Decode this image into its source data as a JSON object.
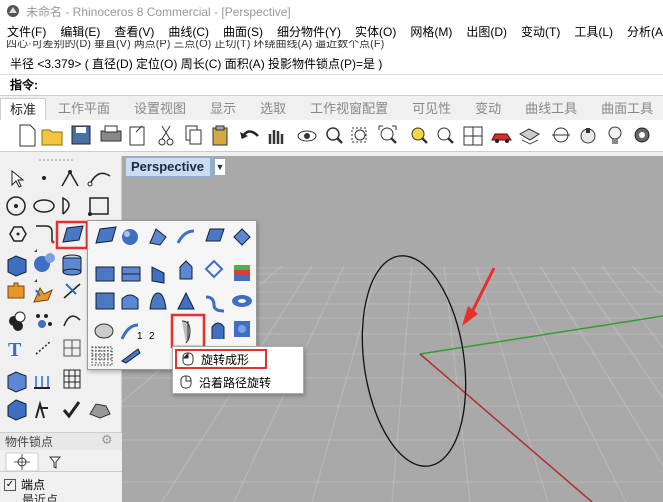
{
  "titlebar": {
    "text": "未命名 - Rhinoceros 8 Commercial - [Perspective]"
  },
  "menus": [
    "文件(F)",
    "编辑(E)",
    "查看(V)",
    "曲线(C)",
    "曲面(S)",
    "细分物件(Y)",
    "实体(O)",
    "网格(M)",
    "出图(D)",
    "变动(T)",
    "工具(L)",
    "分析(A)"
  ],
  "command": {
    "history": "四心·可差别的(D)  垂直(V)  两点(P)  三点(O)  正切(T)  环绕曲线(A)  逼近数个点(F)",
    "line1": "半径 <3.379> ( 直径(D)  定位(O)  周长(C)  面积(A)  投影物件锁点(P)=是 )",
    "prompt": "指令:"
  },
  "tabs": [
    {
      "label": "标准",
      "active": true
    },
    {
      "label": "工作平面"
    },
    {
      "label": "设置视图"
    },
    {
      "label": "显示"
    },
    {
      "label": "选取"
    },
    {
      "label": "工作视窗配置"
    },
    {
      "label": "可见性"
    },
    {
      "label": "变动"
    },
    {
      "label": "曲线工具"
    },
    {
      "label": "曲面工具"
    }
  ],
  "viewport": {
    "label": "Perspective",
    "dropdown": "▼"
  },
  "flyout": {
    "numbers": [
      "1",
      "2"
    ]
  },
  "context_menu": {
    "item1": "旋转成形",
    "item2": "沿着路径旋转"
  },
  "osnap": {
    "title": "物件锁点",
    "gear": "⚙",
    "item1": "端点",
    "item1_check": "✓",
    "item2": "最近点"
  },
  "colors": {
    "highlight": "#e53030",
    "grid_x": "#b03030",
    "grid_y": "#2fa02f",
    "viewport_bg": "#a9a9a9",
    "tab_active": "#c9dcf1"
  }
}
